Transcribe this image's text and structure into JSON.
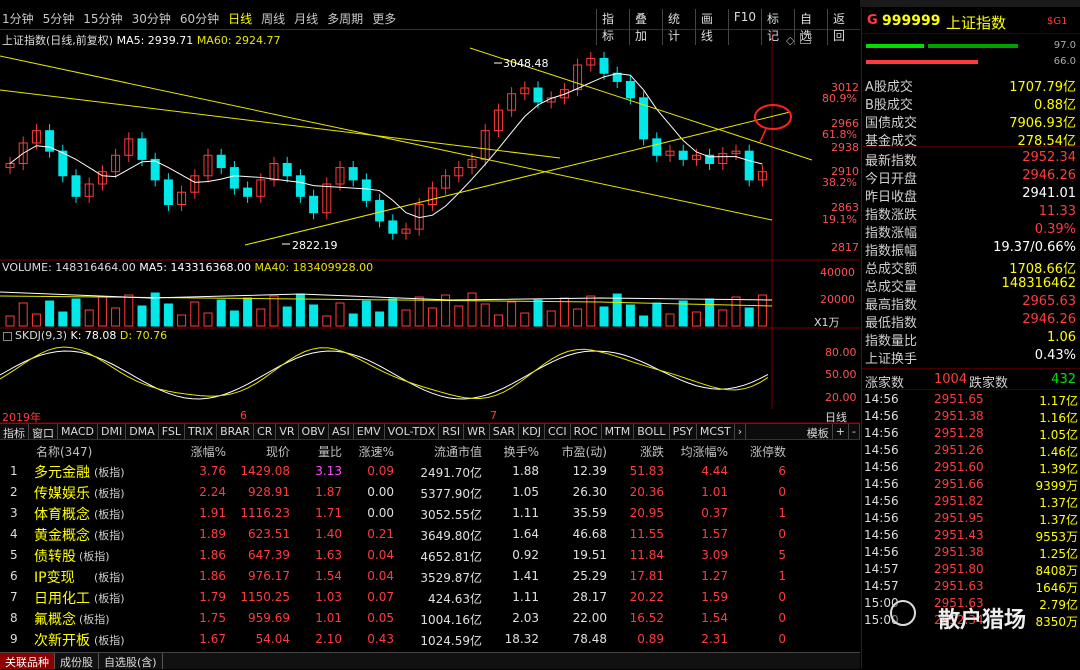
{
  "topbar": {
    "periods": [
      "1分钟",
      "5分钟",
      "15分钟",
      "30分钟",
      "60分钟",
      "日线",
      "周线",
      "月线",
      "多周期",
      "更多"
    ],
    "active_period": "日线",
    "tools": [
      "指标",
      "叠加",
      "统计",
      "画线",
      "F10",
      "标记",
      "自选",
      "返回"
    ]
  },
  "chart": {
    "main_title": "上证指数(日线,前复权)",
    "ma5_label": "MA5: 2939.71",
    "ma60_label": "MA60: 2924.77",
    "high_mark": "3048.48",
    "low_mark": "2822.19",
    "price_ticks": [
      "3012",
      "2966",
      "2938",
      "2910",
      "2863",
      "2817"
    ],
    "pct_ticks": [
      "80.9%",
      "61.8%",
      "38.2%",
      "19.1%"
    ],
    "volume_title": "VOLUME: 148316464.00",
    "vol_ma5": "MA5: 143316368.00",
    "vol_ma40": "MA40: 183409928.00",
    "vol_ticks": [
      "40000",
      "20000"
    ],
    "vol_unit": "X1万",
    "skdj_title": "SKDJ(9,3)",
    "skdj_k": "K: 78.08",
    "skdj_d": "D: 70.76",
    "skdj_ticks": [
      "80.00",
      "50.00",
      "20.00"
    ],
    "date_labels": [
      "2019年",
      "6",
      "7"
    ],
    "date_right": "日线"
  },
  "indicator_tabs": [
    "指标",
    "窗口",
    "MACD",
    "DMI",
    "DMA",
    "FSL",
    "TRIX",
    "BRAR",
    "CR",
    "VR",
    "OBV",
    "ASI",
    "EMV",
    "VOL-TDX",
    "RSI",
    "WR",
    "SAR",
    "KDJ",
    "CCI",
    "ROC",
    "MTM",
    "BOLL",
    "PSY",
    "MCST",
    "›"
  ],
  "indicator_right": [
    "模板",
    "+",
    "-"
  ],
  "table": {
    "headers": [
      "名称(347)",
      "涨幅%",
      "现价",
      "量比",
      "涨速%",
      "流通市值",
      "换手%",
      "市盈(动)",
      "涨跌",
      "均涨幅%",
      "涨停数"
    ],
    "rows": [
      {
        "n": "1",
        "name": "多元金融",
        "tag": "(板指)",
        "chg": "3.76",
        "price": "1429.08",
        "vr": "3.13",
        "spd": "0.09",
        "mcap": "2491.70亿",
        "turn": "1.88",
        "pe": "12.39",
        "diff": "51.83",
        "avg": "4.44",
        "lim": "6"
      },
      {
        "n": "2",
        "name": "传媒娱乐",
        "tag": "(板指)",
        "chg": "2.24",
        "price": "928.91",
        "vr": "1.87",
        "spd": "0.00",
        "mcap": "5377.90亿",
        "turn": "1.05",
        "pe": "26.30",
        "diff": "20.36",
        "avg": "1.01",
        "lim": "0"
      },
      {
        "n": "3",
        "name": "体育概念",
        "tag": "(板指)",
        "chg": "1.91",
        "price": "1116.23",
        "vr": "1.71",
        "spd": "0.00",
        "mcap": "3052.55亿",
        "turn": "1.11",
        "pe": "35.59",
        "diff": "20.95",
        "avg": "0.37",
        "lim": "1"
      },
      {
        "n": "4",
        "name": "黄金概念",
        "tag": "(板指)",
        "chg": "1.89",
        "price": "623.51",
        "vr": "1.40",
        "spd": "0.21",
        "mcap": "3649.80亿",
        "turn": "1.64",
        "pe": "46.68",
        "diff": "11.55",
        "avg": "1.57",
        "lim": "0"
      },
      {
        "n": "5",
        "name": "债转股",
        "tag": "(板指)",
        "chg": "1.86",
        "price": "647.39",
        "vr": "1.63",
        "spd": "0.04",
        "mcap": "4652.81亿",
        "turn": "0.92",
        "pe": "19.51",
        "diff": "11.84",
        "avg": "3.09",
        "lim": "5"
      },
      {
        "n": "6",
        "name": "IP变现",
        "tag": "(板指)",
        "chg": "1.86",
        "price": "976.17",
        "vr": "1.54",
        "spd": "0.04",
        "mcap": "3529.87亿",
        "turn": "1.41",
        "pe": "25.29",
        "diff": "17.81",
        "avg": "1.27",
        "lim": "1"
      },
      {
        "n": "7",
        "name": "日用化工",
        "tag": "(板指)",
        "chg": "1.79",
        "price": "1150.25",
        "vr": "1.03",
        "spd": "0.07",
        "mcap": "424.63亿",
        "turn": "1.11",
        "pe": "28.17",
        "diff": "20.22",
        "avg": "1.59",
        "lim": "0"
      },
      {
        "n": "8",
        "name": "氟概念",
        "tag": "(板指)",
        "chg": "1.75",
        "price": "959.69",
        "vr": "1.01",
        "spd": "0.05",
        "mcap": "1004.16亿",
        "turn": "2.03",
        "pe": "22.00",
        "diff": "16.52",
        "avg": "1.54",
        "lim": "0"
      },
      {
        "n": "9",
        "name": "次新开板",
        "tag": "(板指)",
        "chg": "1.67",
        "price": "54.04",
        "vr": "2.10",
        "spd": "0.43",
        "mcap": "1024.59亿",
        "turn": "18.32",
        "pe": "78.48",
        "diff": "0.89",
        "avg": "2.31",
        "lim": "0"
      }
    ]
  },
  "bottom_tabs": [
    "关联品种",
    "成份股",
    "自选股(含)"
  ],
  "right_panel": {
    "code": "999999",
    "name": "上证指数",
    "flag": "G",
    "badge": "$G1",
    "bar_pct_1": "97.0",
    "bar_pct_2": "66.0",
    "turnover": [
      {
        "k": "A股成交",
        "v": "1707.79亿"
      },
      {
        "k": "B股成交",
        "v": "0.88亿"
      },
      {
        "k": "国债成交",
        "v": "7906.93亿"
      },
      {
        "k": "基金成交",
        "v": "278.54亿"
      }
    ],
    "stats": [
      {
        "k": "最新指数",
        "v": "2952.34",
        "c": "red"
      },
      {
        "k": "今日开盘",
        "v": "2946.26",
        "c": "red"
      },
      {
        "k": "昨日收盘",
        "v": "2941.01",
        "c": "wht"
      },
      {
        "k": "指数涨跌",
        "v": "11.33",
        "c": "red"
      },
      {
        "k": "指数涨幅",
        "v": "0.39%",
        "c": "red"
      },
      {
        "k": "指数振幅",
        "v": "19.37/0.66%",
        "c": "wht"
      },
      {
        "k": "总成交额",
        "v": "1708.66亿",
        "c": "yel"
      },
      {
        "k": "总成交量",
        "v": "148316462",
        "c": "yel"
      },
      {
        "k": "最高指数",
        "v": "2965.63",
        "c": "red"
      },
      {
        "k": "最低指数",
        "v": "2946.26",
        "c": "red"
      },
      {
        "k": "指数量比",
        "v": "1.06",
        "c": "yel"
      },
      {
        "k": "上证换手",
        "v": "0.43%",
        "c": "wht"
      }
    ],
    "up_label": "涨家数",
    "up_count": "1004",
    "down_label": "跌家数",
    "down_count": "432",
    "ticks": [
      {
        "t": "14:56",
        "p": "2951.65",
        "v": "1.17亿"
      },
      {
        "t": "14:56",
        "p": "2951.38",
        "v": "1.16亿"
      },
      {
        "t": "14:56",
        "p": "2951.28",
        "v": "1.05亿"
      },
      {
        "t": "14:56",
        "p": "2951.26",
        "v": "1.46亿"
      },
      {
        "t": "14:56",
        "p": "2951.60",
        "v": "1.39亿"
      },
      {
        "t": "14:56",
        "p": "2951.66",
        "v": "9399万"
      },
      {
        "t": "14:56",
        "p": "2951.82",
        "v": "1.37亿"
      },
      {
        "t": "14:56",
        "p": "2951.95",
        "v": "1.37亿"
      },
      {
        "t": "14:56",
        "p": "2951.43",
        "v": "9553万"
      },
      {
        "t": "14:56",
        "p": "2951.38",
        "v": "1.25亿"
      },
      {
        "t": "14:57",
        "p": "2951.80",
        "v": "8408万"
      },
      {
        "t": "14:57",
        "p": "2951.63",
        "v": "1646万"
      },
      {
        "t": "15:00",
        "p": "2951.63",
        "v": "2.79亿"
      },
      {
        "t": "15:00",
        "p": "2952.34",
        "v": "8350万"
      }
    ]
  },
  "watermark": "散户猎场",
  "colors": {
    "up": "#ff3c3c",
    "down": "#00e8e8",
    "ma5": "#ffffff",
    "ma_yellow": "#e6e600",
    "bg": "#000000"
  }
}
